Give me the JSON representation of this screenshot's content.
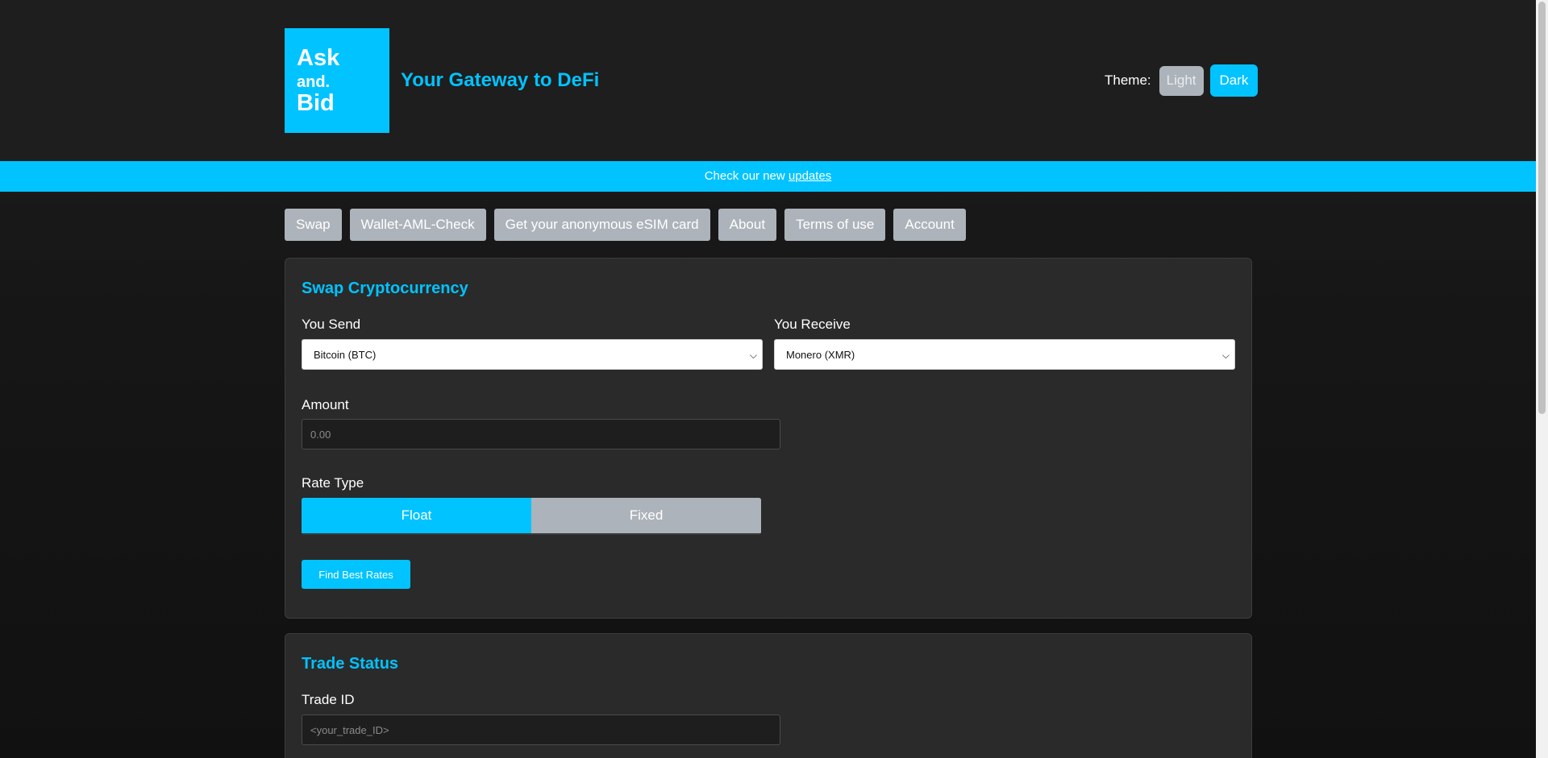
{
  "header": {
    "logo": {
      "line1": "Ask",
      "line2": "and.",
      "line3": "Bid"
    },
    "tagline": "Your Gateway to DeFi",
    "theme": {
      "label": "Theme:",
      "light": "Light",
      "dark": "Dark",
      "selected": "Dark"
    }
  },
  "banner": {
    "text": "Check our new ",
    "link": "updates"
  },
  "nav": {
    "tabs": [
      "Swap",
      "Wallet-AML-Check",
      "Get your anonymous eSIM card",
      "About",
      "Terms of use",
      "Account"
    ]
  },
  "swap": {
    "title": "Swap Cryptocurrency",
    "send": {
      "label": "You Send",
      "value": "Bitcoin (BTC)"
    },
    "receive": {
      "label": "You Receive",
      "value": "Monero (XMR)"
    },
    "amount": {
      "label": "Amount",
      "placeholder": "0.00",
      "value": ""
    },
    "rate": {
      "label": "Rate Type",
      "options": [
        "Float",
        "Fixed"
      ],
      "selected": "Float"
    },
    "submit": "Find Best Rates"
  },
  "trade": {
    "title": "Trade Status",
    "id": {
      "label": "Trade ID",
      "placeholder": "<your_trade_ID>",
      "value": ""
    }
  },
  "colors": {
    "accent": "#00c3ff",
    "muted_button": "#adb3ba",
    "card": "#2a2a2a"
  }
}
